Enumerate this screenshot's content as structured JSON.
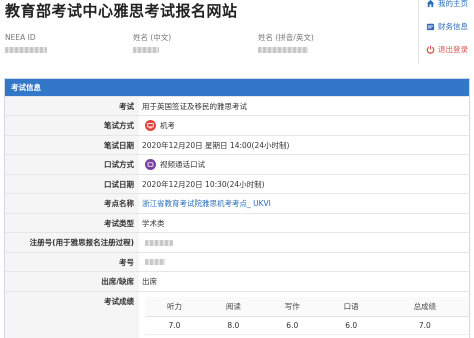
{
  "header": {
    "title": "教育部考试中心雅思考试报名网站"
  },
  "user": {
    "fields": [
      {
        "label": "NEEA ID"
      },
      {
        "label": "姓名 (中文)"
      },
      {
        "label": "姓名 (拼音/英文)"
      }
    ]
  },
  "side_menu": {
    "items": [
      {
        "label": "我的主页",
        "icon": "home-icon"
      },
      {
        "label": "财务信息",
        "icon": "finance-icon"
      },
      {
        "label": "退出登录",
        "icon": "power-icon"
      }
    ]
  },
  "panel": {
    "title": "考试信息",
    "rows": {
      "exam": {
        "label": "考试",
        "value": "用于英国签证及移民的雅思考试"
      },
      "written_mode": {
        "label": "笔试方式",
        "value": "机考"
      },
      "written_date": {
        "label": "笔试日期",
        "value": "2020年12月20日 星期日 14:00(24小时制)"
      },
      "speaking_mode": {
        "label": "口试方式",
        "value": "视频通话口试"
      },
      "speaking_date": {
        "label": "口试日期",
        "value": "2020年12月20日 10:30(24小时制)"
      },
      "venue": {
        "label": "考点名称",
        "value": "浙江省教育考试院雅思机考考点_ UKVI"
      },
      "type": {
        "label": "考试类型",
        "value": "学术类"
      },
      "reg_no": {
        "label": "注册号(用于雅思报名注册过程)"
      },
      "candidate_no": {
        "label": "考号"
      },
      "attendance": {
        "label": "出席/缺席",
        "value": "出席"
      },
      "scores": {
        "label": "考试成绩"
      }
    },
    "score_table": {
      "headers": [
        "听力",
        "阅读",
        "写作",
        "口语",
        "总成绩"
      ],
      "values": [
        "7.0",
        "8.0",
        "6.0",
        "6.0",
        "7.0"
      ]
    }
  },
  "colors": {
    "accent": "#3277c8",
    "link": "#2b6cb8",
    "danger": "#d9534f",
    "computer_badge": "#e0443e",
    "video_badge": "#7b3fa0"
  }
}
